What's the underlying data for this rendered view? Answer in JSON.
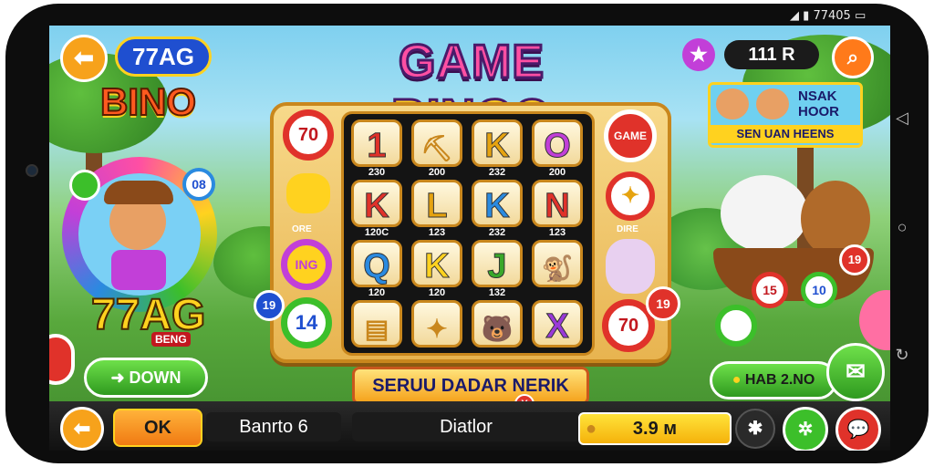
{
  "status_bar": {
    "text": "77405"
  },
  "header": {
    "back_icon": "arrow-left-icon",
    "brand_badge": "77AG",
    "title_part1": "GAME",
    "title_part2": "BINGO",
    "logo_text": "BINO",
    "star_icon": "star-icon",
    "score": "111 R",
    "search_icon": "search-icon"
  },
  "left_panel": {
    "brand_big": "77AG",
    "brand_small": "BENG",
    "chip_left_top": "",
    "down_button": "DOWN"
  },
  "board": {
    "rows": [
      [
        {
          "symbol": "1",
          "color": "#e0322a",
          "label": "230"
        },
        {
          "symbol": "",
          "icon": "treasure-icon",
          "label": "200"
        },
        {
          "symbol": "K",
          "color": "#e6a310",
          "label": "232"
        },
        {
          "symbol": "O",
          "color": "#c23fd8",
          "label": "200"
        }
      ],
      [
        {
          "symbol": "K",
          "color": "#e0322a",
          "label": "120C"
        },
        {
          "symbol": "L",
          "color": "#e6a310",
          "label": "123"
        },
        {
          "symbol": "K",
          "color": "#2a8ae0",
          "label": "232"
        },
        {
          "symbol": "N",
          "color": "#e0322a",
          "label": "123"
        }
      ],
      [
        {
          "symbol": "Q",
          "color": "#2a8ae0",
          "label": "120"
        },
        {
          "symbol": "K",
          "color": "#ffd21f",
          "label": "120"
        },
        {
          "symbol": "J",
          "color": "#3aa82a",
          "label": "132"
        },
        {
          "symbol": "",
          "icon": "monkey-icon",
          "label": ""
        }
      ],
      [
        {
          "symbol": "",
          "icon": "card-icon",
          "label": ""
        },
        {
          "symbol": "",
          "icon": "stars-icon",
          "label": ""
        },
        {
          "symbol": "",
          "icon": "bear-icon",
          "label": ""
        },
        {
          "symbol": "X",
          "color": "#9a3ad8",
          "label": ""
        }
      ]
    ],
    "left_chips": [
      "70",
      "",
      "ING",
      "14"
    ],
    "left_labels": [
      "ORE",
      ""
    ],
    "right_chips": [
      "GAME",
      "",
      "",
      "70"
    ],
    "right_labels": [
      "DIRE"
    ],
    "chip_mid_right": "19",
    "chip_left_edge": "19",
    "chip_x": "80"
  },
  "banner": {
    "text": "SERUU DADAR NERIK",
    "badge": "Y"
  },
  "right_panel": {
    "card_title": "NSAK HOOR",
    "card_subtitle": "SEN UAN HEENS",
    "chips": [
      "15",
      "10",
      "19"
    ],
    "hab_button": "HAB 2.NO"
  },
  "bottom_bar": {
    "back_icon": "arrow-left-icon",
    "ok_button": "OK",
    "field1": "Banrto 6",
    "field2": "Diatlor",
    "coin_value": "3.9 ᴍ",
    "settings_icon": "gear-icon",
    "refresh_icon": "refresh-icon",
    "chat_icon": "chat-icon"
  },
  "colors": {
    "orange": "#f28a16",
    "green": "#3cbf2a",
    "blue": "#1f5bd6",
    "gold": "#ffd21f"
  }
}
